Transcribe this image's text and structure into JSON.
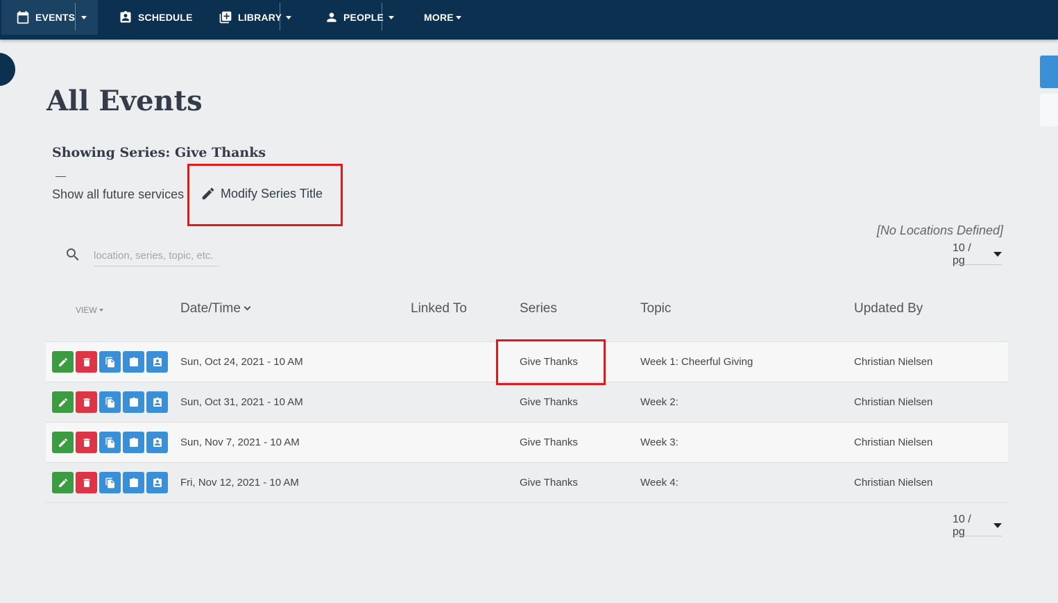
{
  "nav": {
    "events": "EVENTS",
    "schedule": "SCHEDULE",
    "library": "LIBRARY",
    "people": "PEOPLE",
    "more": "MORE"
  },
  "page": {
    "title": "All Events",
    "series_heading": "Showing Series: Give Thanks",
    "show_future": "Show all future services",
    "modify_title": "Modify Series Title",
    "no_locations": "[No Locations Defined]"
  },
  "search": {
    "placeholder": "location, series, topic, etc."
  },
  "per_page": {
    "top": "10 / pg",
    "bottom": "10 / pg"
  },
  "table": {
    "view_label": "VIEW",
    "columns": {
      "datetime": "Date/Time",
      "linked_to": "Linked To",
      "series": "Series",
      "topic": "Topic",
      "updated_by": "Updated By"
    },
    "rows": [
      {
        "datetime": "Sun, Oct 24, 2021 - 10 AM",
        "linked_to": "",
        "series": "Give Thanks",
        "topic": "Week 1: Cheerful Giving",
        "updated_by": "Christian Nielsen"
      },
      {
        "datetime": "Sun, Oct 31, 2021 - 10 AM",
        "linked_to": "",
        "series": "Give Thanks",
        "topic": "Week 2:",
        "updated_by": "Christian Nielsen"
      },
      {
        "datetime": "Sun, Nov 7, 2021 - 10 AM",
        "linked_to": "",
        "series": "Give Thanks",
        "topic": "Week 3:",
        "updated_by": "Christian Nielsen"
      },
      {
        "datetime": "Fri, Nov 12, 2021 - 10 AM",
        "linked_to": "",
        "series": "Give Thanks",
        "topic": "Week 4:",
        "updated_by": "Christian Nielsen"
      }
    ]
  },
  "colors": {
    "nav_bg": "#0c3150",
    "edit": "#3d9b42",
    "delete": "#dc3545",
    "action": "#3a8fd6",
    "highlight": "#e0191c"
  }
}
